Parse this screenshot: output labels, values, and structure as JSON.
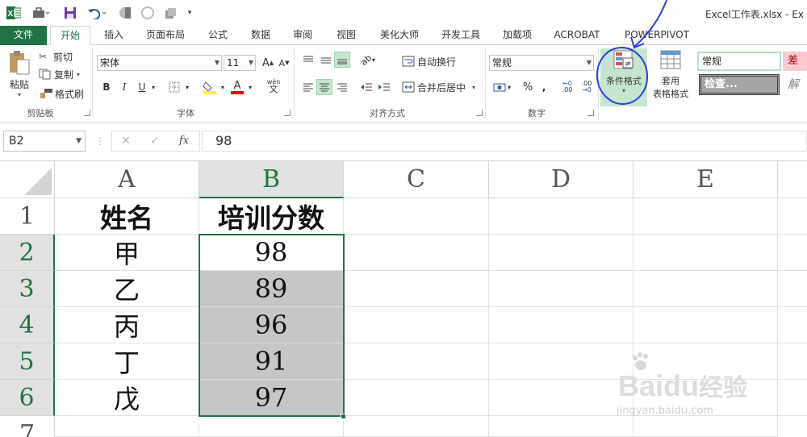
{
  "app": {
    "title": "Excel工作表.xlsx - Ex"
  },
  "tabs": [
    {
      "label": "文件",
      "active": false,
      "file": true
    },
    {
      "label": "开始",
      "active": true
    },
    {
      "label": "插入"
    },
    {
      "label": "页面布局"
    },
    {
      "label": "公式"
    },
    {
      "label": "数据"
    },
    {
      "label": "审阅"
    },
    {
      "label": "视图"
    },
    {
      "label": "美化大师"
    },
    {
      "label": "开发工具"
    },
    {
      "label": "加载项"
    },
    {
      "label": "ACROBAT"
    },
    {
      "label": "POWERPIVOT"
    }
  ],
  "ribbon": {
    "clipboard": {
      "paste": "粘贴",
      "cut": "剪切",
      "copy": "复制",
      "format_painter": "格式刷",
      "group": "剪贴板"
    },
    "font": {
      "name": "宋体",
      "size": "11",
      "bold": "B",
      "italic": "I",
      "underline": "U",
      "group": "字体",
      "grow": "A",
      "shrink": "A",
      "phonetic": "wén"
    },
    "alignment": {
      "wrap": "自动换行",
      "merge": "合并后居中",
      "group": "对齐方式"
    },
    "number": {
      "format": "常规",
      "percent": "%",
      "comma": ",",
      "inc_decimal": ".00",
      "dec_decimal": ".00",
      "group": "数字"
    },
    "styles": {
      "conditional_format": "条件格式",
      "table_format_1": "套用",
      "table_format_2": "表格格式",
      "style_normal": "常规",
      "style_bad": "差",
      "style_check": "检查...",
      "style_explain": "解"
    }
  },
  "formula_bar": {
    "name_box": "B2",
    "cancel": "✕",
    "enter": "✓",
    "fx": "fx",
    "value": "98"
  },
  "columns": [
    "A",
    "B",
    "C",
    "D",
    "E"
  ],
  "rows": [
    "1",
    "2",
    "3",
    "4",
    "5",
    "6",
    "7"
  ],
  "sheet": {
    "headers": [
      "姓名",
      "培训分数"
    ],
    "records": [
      {
        "name": "甲",
        "score": "98"
      },
      {
        "name": "乙",
        "score": "89"
      },
      {
        "name": "丙",
        "score": "96"
      },
      {
        "name": "丁",
        "score": "91"
      },
      {
        "name": "戊",
        "score": "97"
      }
    ]
  },
  "colors": {
    "accent": "#217346",
    "highlight": "#c6c6c6",
    "annotation": "#2a3fe0",
    "style_bad_bg": "#ffc7ce",
    "style_bad_fg": "#9c0006",
    "style_check_bg": "#a5a5a5"
  },
  "watermark": {
    "brand": "Bai",
    "brand2": "du",
    "cn": "经验",
    "url": "jingyan.baidu.com"
  }
}
